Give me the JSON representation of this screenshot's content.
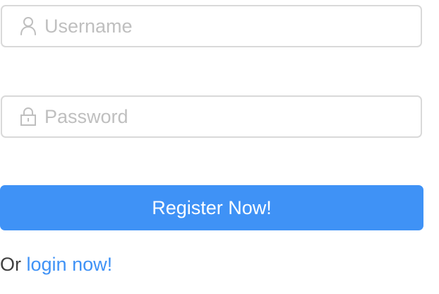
{
  "form": {
    "username": {
      "placeholder": "Username",
      "value": "",
      "icon": "user-icon"
    },
    "password": {
      "placeholder": "Password",
      "value": "",
      "icon": "lock-icon"
    },
    "register_label": "Register Now!",
    "footer": {
      "prefix": "Or",
      "link_label": "login now!"
    }
  },
  "colors": {
    "accent": "#3f92f6",
    "border": "#d9d9d9",
    "placeholder": "#bfbfbf",
    "text": "#404040"
  }
}
